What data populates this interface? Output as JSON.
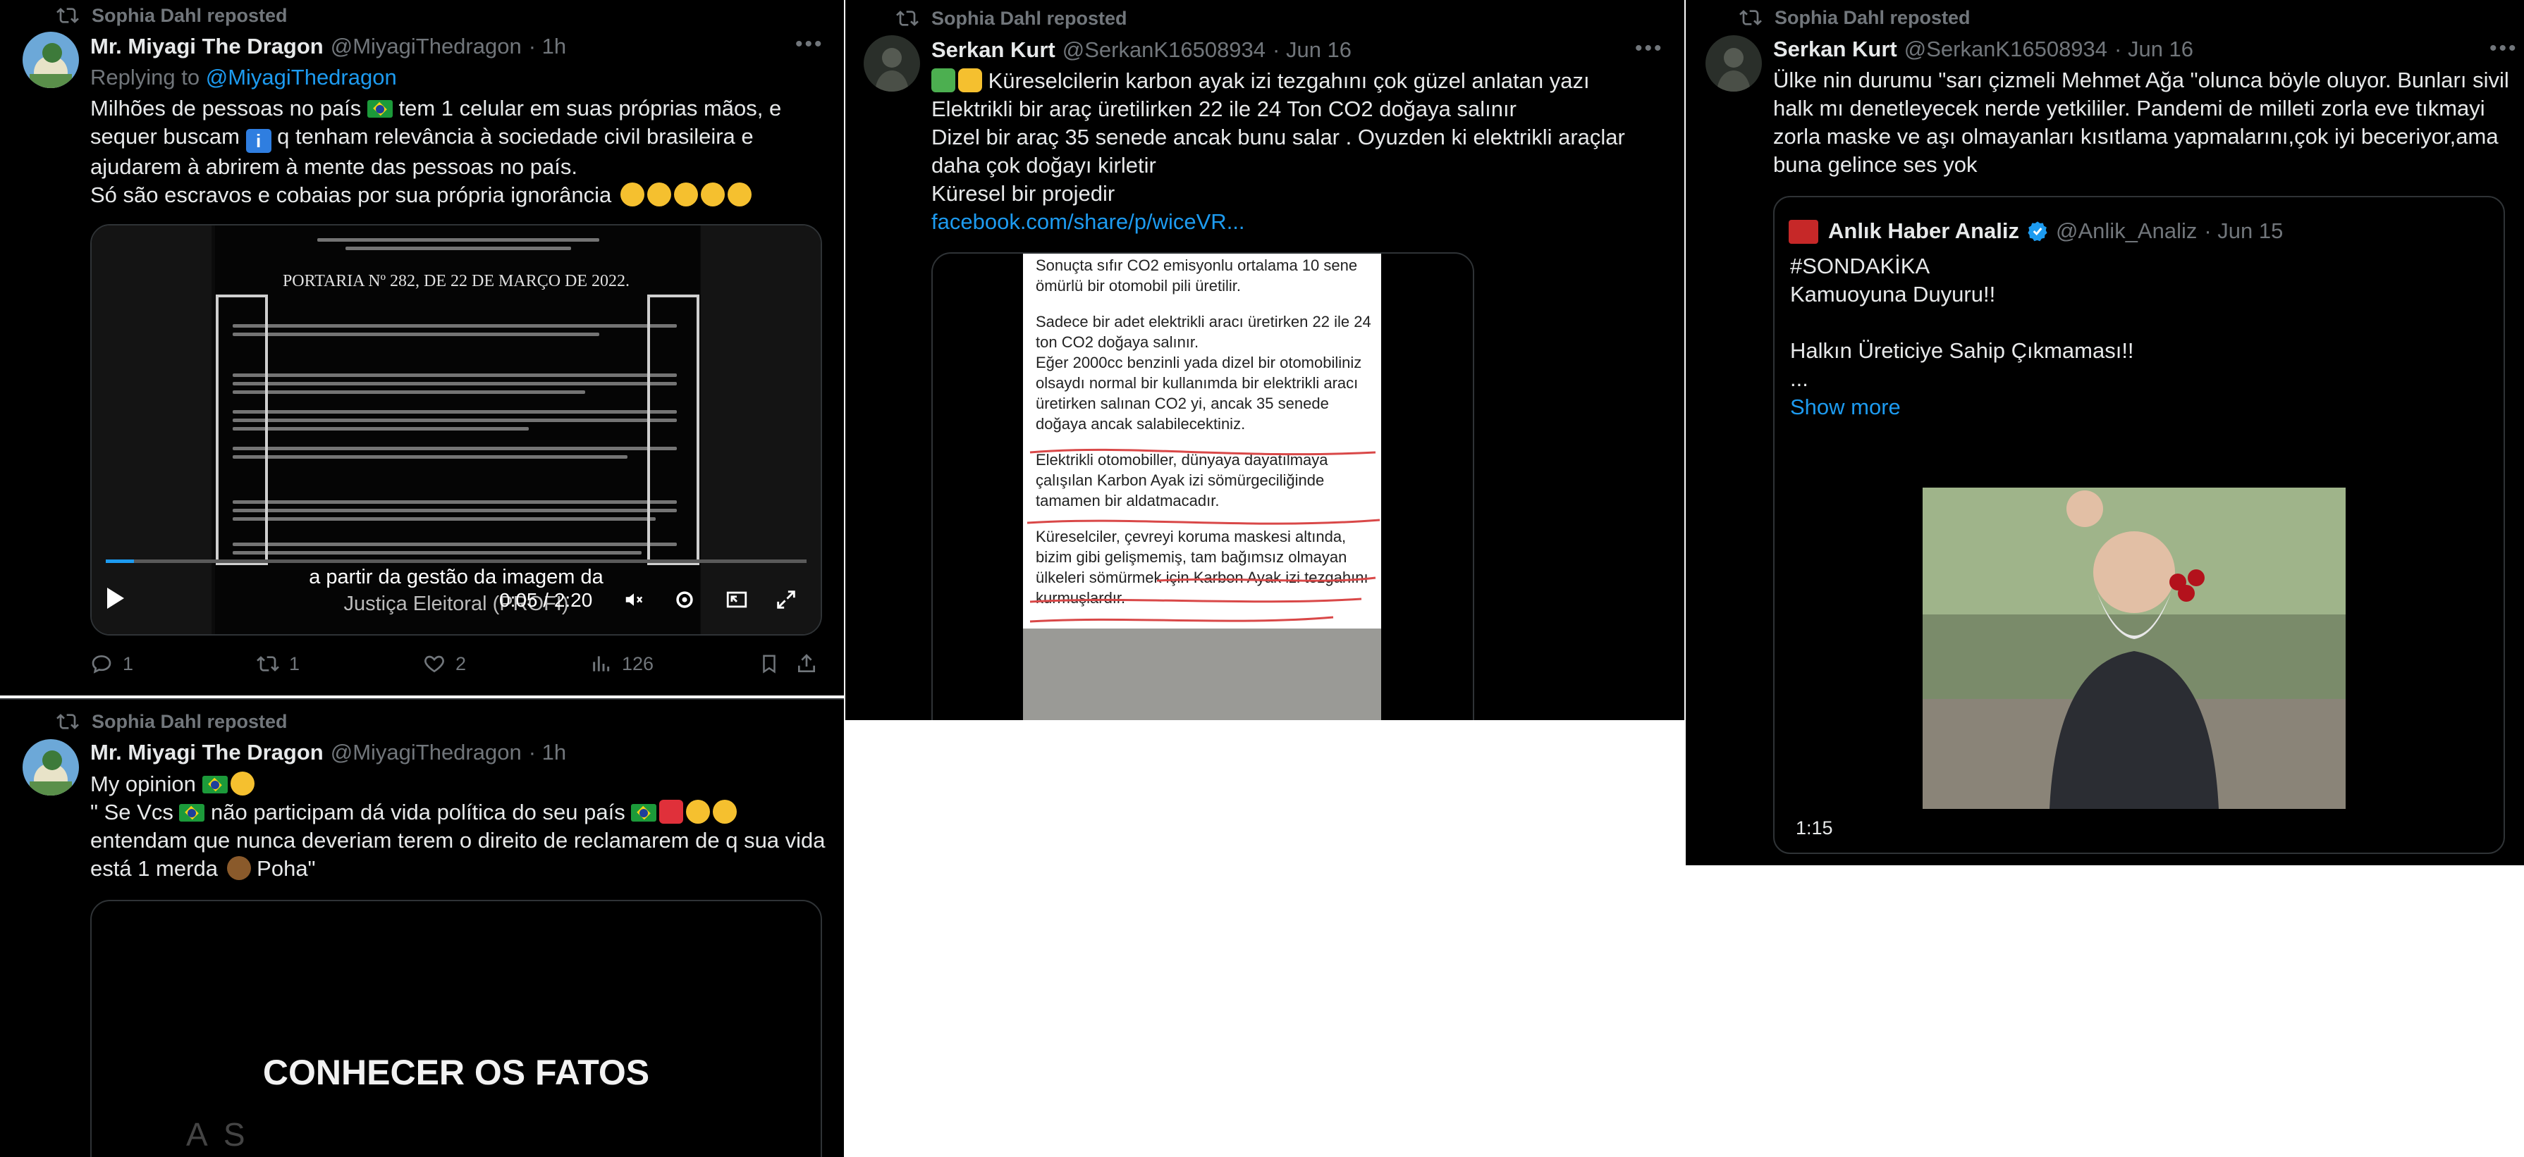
{
  "repost_label": "Sophia Dahl reposted",
  "tweet1": {
    "name": "Mr. Miyagi The Dragon",
    "handle": "@MiyagiThedragon",
    "time": "· 1h",
    "replying_prefix": "Replying to ",
    "replying_handle": "@MiyagiThedragon",
    "line1_a": "Milhões de pessoas no país ",
    "line1_b": " tem 1 celular em suas próprias mãos, e",
    "line2_a": "sequer buscam ",
    "line2_b": " q tenham relevância à sociedade civil brasileira e",
    "line3": "ajudarem à abrirem à mente das pessoas no país.",
    "line4": "Só são escravos e cobaias por sua própria ignorância",
    "info_glyph": "i",
    "doc_title": "PORTARIA Nº 282, DE 22 DE MARÇO DE 2022.",
    "caption1": "a partir da gestão da imagem da",
    "caption2": "Justiça Eleitoral (PROFI)",
    "video_time": "0:05 / 2:20",
    "replies": "1",
    "reposts": "1",
    "likes": "2",
    "views": "126"
  },
  "tweet2": {
    "name": "Mr. Miyagi The Dragon",
    "handle": "@MiyagiThedragon",
    "time": "· 1h",
    "line1": "My opinion",
    "line2_a": "\" Se Vcs ",
    "line2_b": " não participam dá vida política do seu país",
    "line3": "entendam que nunca deveriam terem o direito de reclamarem de q sua vida",
    "line4_a": "está 1 merda ",
    "line4_b": " Poha\"",
    "video_title": "CONHECER OS FATOS",
    "video_sub": "A S"
  },
  "tweet3": {
    "name": "Serkan Kurt",
    "handle": "@SerkanK16508934",
    "time": "· Jun 16",
    "lines": [
      "Küreselcilerin karbon ayak izi tezgahını çok güzel anlatan yazı",
      "Elektrikli bir araç üretilirken 22 ile 24 Ton CO2 doğaya salınır",
      "Dizel bir araç 35 senede ancak bunu salar . Oyuzden ki elektrikli araçlar",
      "daha çok doğayı kirletir",
      "Küresel bir projedir"
    ],
    "link": "facebook.com/share/p/wiceVR...",
    "doc_paragraphs": [
      "Sonuçta sıfır CO2 emisyonlu ortalama 10 sene ömürlü bir otomobil pili üretilir.",
      "Sadece bir adet elektrikli aracı üretirken 22 ile 24 ton CO2 doğaya salınır.\nEğer 2000cc benzinli yada dizel bir otomobiliniz olsaydı normal bir kullanımda bir elektrikli aracı üretirken salınan CO2 yi, ancak 35 senede doğaya ancak salabilecektiniz.",
      "Elektrikli otomobiller, dünyaya dayatılmaya çalışılan Karbon Ayak izi sömürgeciliğinde tamamen bir aldatmacadır.",
      "Küreselciler, çevreyi koruma  maskesi altında, bizim gibi gelişmemiş, tam bağımsız olmayan ülkeleri sömürmek için Karbon Ayak izi tezgahını kurmuşlardır."
    ]
  },
  "tweet4": {
    "name": "Serkan Kurt",
    "handle": "@SerkanK16508934",
    "time": "· Jun 16",
    "lines": [
      "Ülke nin durumu \"sarı çizmeli Mehmet Ağa \"olunca böyle oluyor. Bunları sivil",
      "halk mı denetleyecek nerde yetkililer. Pandemi de milleti zorla eve tıkmayi",
      "zorla maske ve aşı olmayanları kısıtlama yapmalarını,çok iyi beceriyor,ama",
      "buna gelince ses yok"
    ],
    "quote": {
      "name": "Anlık Haber Analiz",
      "handle": "@Anlik_Analiz",
      "time": "· Jun 15",
      "lines": [
        "#SONDAKİKA",
        "Kamuoyuna Duyuru!!",
        "",
        "Halkın Üreticiye Sahip Çıkmaması!!",
        "..."
      ],
      "show_more": "Show more",
      "duration": "1:15"
    }
  },
  "colors": {
    "background": "#000000",
    "text": "#e7e9ea",
    "muted": "#71767b",
    "link": "#1d9bf0",
    "border": "#2f3336"
  }
}
